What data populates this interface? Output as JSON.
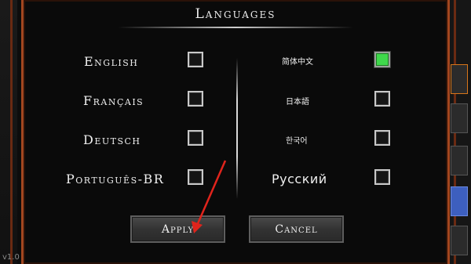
{
  "dialog": {
    "title": "Languages",
    "languages_left": [
      {
        "label": "English",
        "checked": false
      },
      {
        "label": "Français",
        "checked": false
      },
      {
        "label": "Deutsch",
        "checked": false
      },
      {
        "label": "Português-BR",
        "checked": false
      }
    ],
    "languages_right": [
      {
        "label": "简体中文",
        "checked": true
      },
      {
        "label": "日本語",
        "checked": false
      },
      {
        "label": "한국어",
        "checked": false
      },
      {
        "label": "Русский",
        "checked": false
      }
    ],
    "apply_label": "Apply",
    "cancel_label": "Cancel"
  },
  "version": "v1.0",
  "colors": {
    "frame": "#a2461f",
    "checked": "#3fd84b",
    "annotation_arrow": "#e0241c"
  }
}
